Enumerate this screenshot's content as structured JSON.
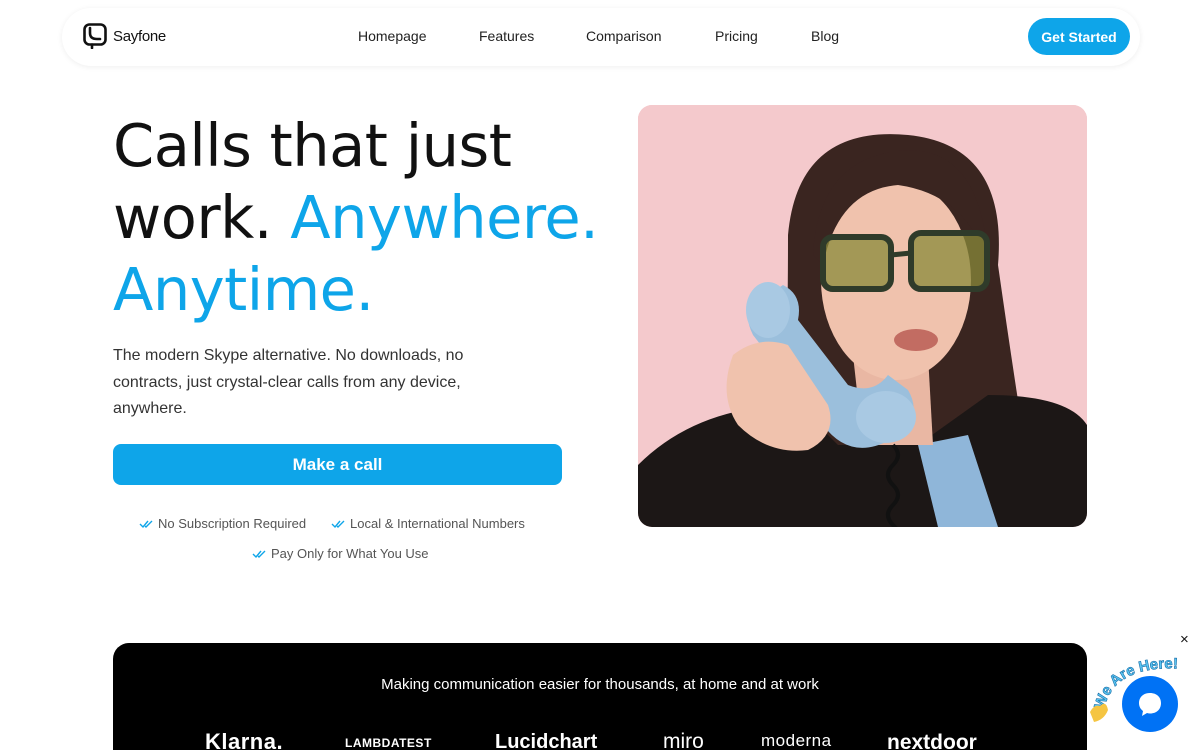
{
  "brand": {
    "name": "Sayfone",
    "logo_icon": "phone-handset-icon"
  },
  "nav": {
    "links": [
      "Homepage",
      "Features",
      "Comparison",
      "Pricing",
      "Blog"
    ],
    "cta_label": "Get Started"
  },
  "hero": {
    "title_line1": "Calls that just",
    "title_line2_plain": "work. ",
    "title_line2_accent": "Anywhere.",
    "title_line3_accent": "Anytime.",
    "subtitle": "The modern Skype alternative. No downloads, no contracts, just crystal-clear calls from any device, anywhere.",
    "button_label": "Make a call",
    "features": [
      "No Subscription Required",
      "Local & International Numbers",
      "Pay Only for What You Use"
    ]
  },
  "band": {
    "text": "Making communication easier for thousands, at home and at work",
    "logos": [
      "Klarna.",
      "LAMBDATEST",
      "Lucidchart",
      "miro",
      "moderna",
      "nextdoor"
    ]
  },
  "chat_widget": {
    "label": "We Are Here!",
    "close": "×",
    "icon": "chat-bubble-icon"
  },
  "colors": {
    "accent": "#0ea5e9",
    "band_background": "#000000",
    "hero_image_background": "#f4c9cc",
    "chat_button": "#0072f5"
  }
}
